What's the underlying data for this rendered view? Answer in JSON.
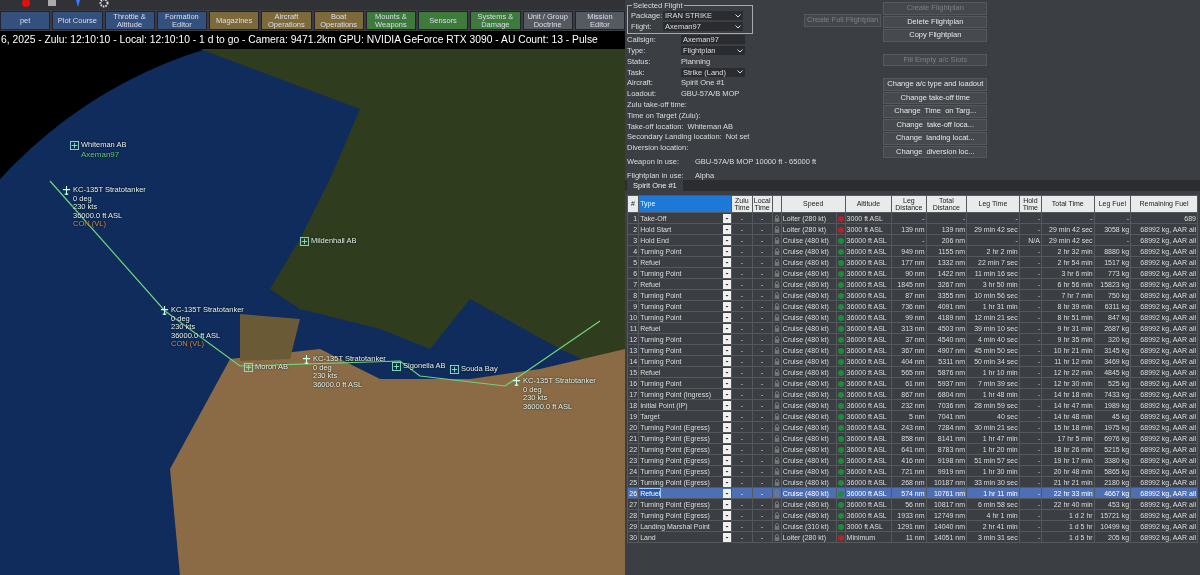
{
  "toolbar": {
    "buttons": [
      {
        "label": "pet"
      },
      {
        "label": "Plot Course"
      },
      {
        "label": "Throttle & Altitude"
      },
      {
        "label": "Formation Editor"
      },
      {
        "label": "Magazines"
      },
      {
        "label": "Aircraft Operations"
      },
      {
        "label": "Boat Operations"
      },
      {
        "label": "Mounts & Weapons"
      },
      {
        "label": "Sensors"
      },
      {
        "label": "Systems & Damage"
      },
      {
        "label": "Unit / Group Doctrine"
      },
      {
        "label": "Mission Editor"
      }
    ]
  },
  "status_line": "6, 2025 - Zulu: 12:10:10 - Local: 12:10:10 - 1 d to go - Camera: 9471.2km GPU: NVIDIA GeForce RTX 3090 - AU Count: 13 - Pulse",
  "map_markers": [
    {
      "kind": "base",
      "label": "Whiteman AB",
      "sub": "Axeman97"
    },
    {
      "kind": "tanker",
      "label": "KC-135T Stratotanker",
      "details": [
        "0 deg",
        "230 kts",
        "36000.0 ft ASL"
      ],
      "status": "CON (VL)"
    },
    {
      "kind": "base",
      "label": "Mildenhall AB"
    },
    {
      "kind": "tanker",
      "label": "KC-135T Stratotanker",
      "details": [
        "0 deg",
        "230 kts",
        "36000.0 ft ASL"
      ],
      "status": "CON (VL)"
    },
    {
      "kind": "base",
      "label": "Moron AB"
    },
    {
      "kind": "tanker",
      "label": "KC-135T Stratotanker",
      "details": [
        "0 deg",
        "230 kts",
        "36000.0 ft ASL"
      ]
    },
    {
      "kind": "base",
      "label": "Sigonella AB"
    },
    {
      "kind": "base",
      "label": "Souda Bay"
    },
    {
      "kind": "tanker",
      "label": "KC-135T Stratotanker",
      "details": [
        "0 deg",
        "230 kts",
        "36000.0 ft ASL"
      ]
    }
  ],
  "selected_flight": {
    "title": "Selected Flight",
    "package_label": "Package:",
    "package": "IRAN STRIKE",
    "flight_label": "Flight:",
    "flight": "Axeman97"
  },
  "create_full_button": {
    "label": "Create Full Flightplan",
    "disabled": true
  },
  "fields": [
    {
      "label": "Callsign:",
      "value": "Axeman97",
      "kind": "input"
    },
    {
      "label": "Type:",
      "value": "Flightplan",
      "kind": "select"
    },
    {
      "label": "Status:",
      "value": "Planning",
      "kind": "text"
    },
    {
      "label": "Task:",
      "value": "Strike (Land)",
      "kind": "select"
    },
    {
      "label": "Aircraft:",
      "value": "Spirit One #1",
      "kind": "text"
    },
    {
      "label": "Loadout:",
      "value": "GBU-57A/B MOP",
      "kind": "text"
    },
    {
      "label": "Zulu take-off time:",
      "kind": "text"
    },
    {
      "label": "Time on Target (Zulu):",
      "kind": "text"
    },
    {
      "label": "Take-off location:",
      "value": "Whiteman AB",
      "kind": "text"
    },
    {
      "label": "Secondary Landing location:",
      "value": "Not set",
      "kind": "text"
    },
    {
      "label": "Diversion location:",
      "kind": "text"
    },
    {
      "label": "Weapon in use:",
      "value": "GBU-57A/B MOP 10000 ft - 65000 ft",
      "kind": "text"
    },
    {
      "label": "Flightplan in use:",
      "value": "Alpha",
      "kind": "text"
    }
  ],
  "action_groups": [
    {
      "buttons": [
        {
          "label": "Create Flightplan",
          "disabled": true
        },
        {
          "label": "Delete Flightplan",
          "disabled": false
        },
        {
          "label": "Copy Flightplan",
          "disabled": false
        }
      ]
    },
    {
      "buttons": [
        {
          "label": "Fill Empty a/c Slots",
          "disabled": true
        }
      ]
    },
    {
      "buttons": [
        {
          "label": "Change a/c type and loadout",
          "disabled": false
        },
        {
          "label": "Change take-off time",
          "disabled": false
        },
        {
          "label": "Change  Time  on Targ...",
          "disabled": false
        },
        {
          "label": "Change  take-off loca...",
          "disabled": false
        },
        {
          "label": "Change  landing locat...",
          "disabled": false
        },
        {
          "label": "Change  diversion loc...",
          "disabled": false
        }
      ]
    }
  ],
  "tabs": [
    {
      "label": "Spirit One #1",
      "selected": true
    }
  ],
  "table": {
    "columns": [
      {
        "label": "#",
        "selected": false
      },
      {
        "label": "Type",
        "selected": true
      },
      {
        "label": "Zulu Time",
        "selected": false
      },
      {
        "label": "Local Time",
        "selected": false
      },
      {
        "label": "Speed",
        "selected": false
      },
      {
        "label": "Altitude",
        "selected": false
      },
      {
        "label": "Leg Distance",
        "selected": false
      },
      {
        "label": "Total Distance",
        "selected": false
      },
      {
        "label": "Leg Time",
        "selected": false
      },
      {
        "label": "Hold Time",
        "selected": false
      },
      {
        "label": "Total Time",
        "selected": false
      },
      {
        "label": "Leg Fuel",
        "selected": false
      },
      {
        "label": "Remaining Fuel",
        "selected": false
      }
    ],
    "rows": [
      {
        "n": "1",
        "type": "Take-Off",
        "zulu": "-",
        "local": "-",
        "speed": "Loiter (280 kt)",
        "color": "#b3232a",
        "altitude": "3000 ft ASL",
        "leg_distance": "-",
        "total_distance": "-",
        "leg_time": "-",
        "hold_time": "-",
        "total_time": "-",
        "leg_fuel": "-",
        "remaining_fuel": "689",
        "selected": false
      },
      {
        "n": "2",
        "type": "Hold Start",
        "zulu": "-",
        "local": "-",
        "speed": "Loiter (280 kt)",
        "color": "#b3232a",
        "altitude": "3000 ft ASL",
        "leg_distance": "139 nm",
        "total_distance": "139 nm",
        "leg_time": "29 min 42 sec",
        "hold_time": "-",
        "total_time": "29 min 42 sec",
        "leg_fuel": "3058 kg",
        "remaining_fuel": "68992 kg, AAR all",
        "selected": false
      },
      {
        "n": "3",
        "type": "Hold End",
        "zulu": "-",
        "local": "-",
        "speed": "Cruise (480 kt)",
        "color": "#1f8a3a",
        "altitude": "36000 ft ASL",
        "leg_distance": "-",
        "total_distance": "206 nm",
        "leg_time": "-",
        "hold_time": "N/A",
        "total_time": "29 min 42 sec",
        "leg_fuel": "-",
        "remaining_fuel": "68992 kg, AAR all",
        "selected": false
      },
      {
        "n": "4",
        "type": "Turning Point",
        "zulu": "-",
        "local": "-",
        "speed": "Cruise (480 kt)",
        "color": "#1f8a3a",
        "altitude": "36000 ft ASL",
        "leg_distance": "949 nm",
        "total_distance": "1155 nm",
        "leg_time": "2 hr 2 min",
        "hold_time": "-",
        "total_time": "2 hr 32 min",
        "leg_fuel": "8880 kg",
        "remaining_fuel": "68992 kg, AAR all",
        "selected": false
      },
      {
        "n": "5",
        "type": "Refuel",
        "zulu": "-",
        "local": "-",
        "speed": "Cruise (480 kt)",
        "color": "#1f8a3a",
        "altitude": "36000 ft ASL",
        "leg_distance": "177 nm",
        "total_distance": "1332 nm",
        "leg_time": "22 min 7 sec",
        "hold_time": "-",
        "total_time": "2 hr 54 min",
        "leg_fuel": "1517 kg",
        "remaining_fuel": "68992 kg, AAR all",
        "selected": false
      },
      {
        "n": "6",
        "type": "Turning Point",
        "zulu": "-",
        "local": "-",
        "speed": "Cruise (480 kt)",
        "color": "#1f8a3a",
        "altitude": "36000 ft ASL",
        "leg_distance": "90 nm",
        "total_distance": "1422 nm",
        "leg_time": "11 min 16 sec",
        "hold_time": "-",
        "total_time": "3 hr 6 min",
        "leg_fuel": "773 kg",
        "remaining_fuel": "68992 kg, AAR all",
        "selected": false
      },
      {
        "n": "7",
        "type": "Refuel",
        "zulu": "-",
        "local": "-",
        "speed": "Cruise (480 kt)",
        "color": "#1f8a3a",
        "altitude": "36000 ft ASL",
        "leg_distance": "1845 nm",
        "total_distance": "3267 nm",
        "leg_time": "3 hr 50 min",
        "hold_time": "-",
        "total_time": "6 hr 56 min",
        "leg_fuel": "15823 kg",
        "remaining_fuel": "68992 kg, AAR all",
        "selected": false
      },
      {
        "n": "8",
        "type": "Turning Point",
        "zulu": "-",
        "local": "-",
        "speed": "Cruise (480 kt)",
        "color": "#1f8a3a",
        "altitude": "36000 ft ASL",
        "leg_distance": "87 nm",
        "total_distance": "3355 nm",
        "leg_time": "10 min 56 sec",
        "hold_time": "-",
        "total_time": "7 hr 7 min",
        "leg_fuel": "750 kg",
        "remaining_fuel": "68992 kg, AAR all",
        "selected": false
      },
      {
        "n": "9",
        "type": "Turning Point",
        "zulu": "-",
        "local": "-",
        "speed": "Cruise (480 kt)",
        "color": "#1f8a3a",
        "altitude": "36000 ft ASL",
        "leg_distance": "736 nm",
        "total_distance": "4091 nm",
        "leg_time": "1 hr 31 min",
        "hold_time": "-",
        "total_time": "8 hr 39 min",
        "leg_fuel": "6311 kg",
        "remaining_fuel": "68992 kg, AAR all",
        "selected": false
      },
      {
        "n": "10",
        "type": "Turning Point",
        "zulu": "-",
        "local": "-",
        "speed": "Cruise (480 kt)",
        "color": "#1f8a3a",
        "altitude": "36000 ft ASL",
        "leg_distance": "99 nm",
        "total_distance": "4189 nm",
        "leg_time": "12 min 21 sec",
        "hold_time": "-",
        "total_time": "8 hr 51 min",
        "leg_fuel": "847 kg",
        "remaining_fuel": "68992 kg, AAR all",
        "selected": false
      },
      {
        "n": "11",
        "type": "Refuel",
        "zulu": "-",
        "local": "-",
        "speed": "Cruise (480 kt)",
        "color": "#1f8a3a",
        "altitude": "36000 ft ASL",
        "leg_distance": "313 nm",
        "total_distance": "4503 nm",
        "leg_time": "39 min 10 sec",
        "hold_time": "-",
        "total_time": "9 hr 31 min",
        "leg_fuel": "2687 kg",
        "remaining_fuel": "68992 kg, AAR all",
        "selected": false
      },
      {
        "n": "12",
        "type": "Turning Point",
        "zulu": "-",
        "local": "-",
        "speed": "Cruise (480 kt)",
        "color": "#1f8a3a",
        "altitude": "36000 ft ASL",
        "leg_distance": "37 nm",
        "total_distance": "4540 nm",
        "leg_time": "4 min 40 sec",
        "hold_time": "-",
        "total_time": "9 hr 35 min",
        "leg_fuel": "320 kg",
        "remaining_fuel": "68992 kg, AAR all",
        "selected": false
      },
      {
        "n": "13",
        "type": "Turning Point",
        "zulu": "-",
        "local": "-",
        "speed": "Cruise (480 kt)",
        "color": "#1f8a3a",
        "altitude": "36000 ft ASL",
        "leg_distance": "367 nm",
        "total_distance": "4907 nm",
        "leg_time": "45 min 50 sec",
        "hold_time": "-",
        "total_time": "10 hr 21 min",
        "leg_fuel": "3145 kg",
        "remaining_fuel": "68992 kg, AAR all",
        "selected": false
      },
      {
        "n": "14",
        "type": "Turning Point",
        "zulu": "-",
        "local": "-",
        "speed": "Cruise (480 kt)",
        "color": "#1f8a3a",
        "altitude": "36000 ft ASL",
        "leg_distance": "404 nm",
        "total_distance": "5311 nm",
        "leg_time": "50 min 34 sec",
        "hold_time": "-",
        "total_time": "11 hr 12 min",
        "leg_fuel": "3469 kg",
        "remaining_fuel": "68992 kg, AAR all",
        "selected": false
      },
      {
        "n": "15",
        "type": "Refuel",
        "zulu": "-",
        "local": "-",
        "speed": "Cruise (480 kt)",
        "color": "#1f8a3a",
        "altitude": "36000 ft ASL",
        "leg_distance": "565 nm",
        "total_distance": "5876 nm",
        "leg_time": "1 hr 10 min",
        "hold_time": "-",
        "total_time": "12 hr 22 min",
        "leg_fuel": "4845 kg",
        "remaining_fuel": "68992 kg, AAR all",
        "selected": false
      },
      {
        "n": "16",
        "type": "Turning Point",
        "zulu": "-",
        "local": "-",
        "speed": "Cruise (480 kt)",
        "color": "#1f8a3a",
        "altitude": "36000 ft ASL",
        "leg_distance": "61 nm",
        "total_distance": "5937 nm",
        "leg_time": "7 min 39 sec",
        "hold_time": "-",
        "total_time": "12 hr 30 min",
        "leg_fuel": "525 kg",
        "remaining_fuel": "68992 kg, AAR all",
        "selected": false
      },
      {
        "n": "17",
        "type": "Turning Point (Ingress)",
        "zulu": "-",
        "local": "-",
        "speed": "Cruise (480 kt)",
        "color": "#1f8a3a",
        "altitude": "36000 ft ASL",
        "leg_distance": "867 nm",
        "total_distance": "6804 nm",
        "leg_time": "1 hr 48 min",
        "hold_time": "-",
        "total_time": "14 hr 18 min",
        "leg_fuel": "7433 kg",
        "remaining_fuel": "68992 kg, AAR all",
        "selected": false
      },
      {
        "n": "18",
        "type": "Initial Point (IP)",
        "zulu": "-",
        "local": "-",
        "speed": "Cruise (480 kt)",
        "color": "#1f8a3a",
        "altitude": "36000 ft ASL",
        "leg_distance": "232 nm",
        "total_distance": "7036 nm",
        "leg_time": "28 min 59 sec",
        "hold_time": "-",
        "total_time": "14 hr 47 min",
        "leg_fuel": "1989 kg",
        "remaining_fuel": "68992 kg, AAR all",
        "selected": false
      },
      {
        "n": "19",
        "type": "Target",
        "zulu": "-",
        "local": "-",
        "speed": "Cruise (480 kt)",
        "color": "#1f8a3a",
        "altitude": "36000 ft ASL",
        "leg_distance": "5 nm",
        "total_distance": "7041 nm",
        "leg_time": "40 sec",
        "hold_time": "-",
        "total_time": "14 hr 48 min",
        "leg_fuel": "45 kg",
        "remaining_fuel": "68992 kg, AAR all",
        "selected": false
      },
      {
        "n": "20",
        "type": "Turning Point (Egress)",
        "zulu": "-",
        "local": "-",
        "speed": "Cruise (480 kt)",
        "color": "#1f8a3a",
        "altitude": "36000 ft ASL",
        "leg_distance": "243 nm",
        "total_distance": "7284 nm",
        "leg_time": "30 min 21 sec",
        "hold_time": "-",
        "total_time": "15 hr 18 min",
        "leg_fuel": "1975 kg",
        "remaining_fuel": "68992 kg, AAR all",
        "selected": false
      },
      {
        "n": "21",
        "type": "Turning Point (Egress)",
        "zulu": "-",
        "local": "-",
        "speed": "Cruise (480 kt)",
        "color": "#1f8a3a",
        "altitude": "36000 ft ASL",
        "leg_distance": "858 nm",
        "total_distance": "8141 nm",
        "leg_time": "1 hr 47 min",
        "hold_time": "-",
        "total_time": "17 hr 5 min",
        "leg_fuel": "6976 kg",
        "remaining_fuel": "68992 kg, AAR all",
        "selected": false
      },
      {
        "n": "22",
        "type": "Turning Point (Egress)",
        "zulu": "-",
        "local": "-",
        "speed": "Cruise (480 kt)",
        "color": "#1f8a3a",
        "altitude": "36000 ft ASL",
        "leg_distance": "641 nm",
        "total_distance": "8783 nm",
        "leg_time": "1 hr 20 min",
        "hold_time": "-",
        "total_time": "18 hr 26 min",
        "leg_fuel": "5215 kg",
        "remaining_fuel": "68992 kg, AAR all",
        "selected": false
      },
      {
        "n": "23",
        "type": "Turning Point (Egress)",
        "zulu": "-",
        "local": "-",
        "speed": "Cruise (480 kt)",
        "color": "#1f8a3a",
        "altitude": "36000 ft ASL",
        "leg_distance": "416 nm",
        "total_distance": "9198 nm",
        "leg_time": "51 min 57 sec",
        "hold_time": "-",
        "total_time": "19 hr 17 min",
        "leg_fuel": "3380 kg",
        "remaining_fuel": "68992 kg, AAR all",
        "selected": false
      },
      {
        "n": "24",
        "type": "Turning Point (Egress)",
        "zulu": "-",
        "local": "-",
        "speed": "Cruise (480 kt)",
        "color": "#1f8a3a",
        "altitude": "36000 ft ASL",
        "leg_distance": "721 nm",
        "total_distance": "9919 nm",
        "leg_time": "1 hr 30 min",
        "hold_time": "-",
        "total_time": "20 hr 48 min",
        "leg_fuel": "5865 kg",
        "remaining_fuel": "68992 kg, AAR all",
        "selected": false
      },
      {
        "n": "25",
        "type": "Turning Point (Egress)",
        "zulu": "-",
        "local": "-",
        "speed": "Cruise (480 kt)",
        "color": "#1f8a3a",
        "altitude": "36000 ft ASL",
        "leg_distance": "268 nm",
        "total_distance": "10187 nm",
        "leg_time": "33 min 30 sec",
        "hold_time": "-",
        "total_time": "21 hr 21 min",
        "leg_fuel": "2180 kg",
        "remaining_fuel": "68992 kg, AAR all",
        "selected": false
      },
      {
        "n": "26",
        "type": "Refuel",
        "zulu": "-",
        "local": "-",
        "speed": "Cruise (480 kt)",
        "color": "#1f8a3a",
        "altitude": "36000 ft ASL",
        "leg_distance": "574 nm",
        "total_distance": "10761 nm",
        "leg_time": "1 hr 11 min",
        "hold_time": "-",
        "total_time": "22 hr 33 min",
        "leg_fuel": "4667 kg",
        "remaining_fuel": "68992 kg, AAR all",
        "selected": true
      },
      {
        "n": "27",
        "type": "Turning Point (Egress)",
        "zulu": "-",
        "local": "-",
        "speed": "Cruise (480 kt)",
        "color": "#1f8a3a",
        "altitude": "36000 ft ASL",
        "leg_distance": "56 nm",
        "total_distance": "10817 nm",
        "leg_time": "6 min 58 sec",
        "hold_time": "-",
        "total_time": "22 hr 40 min",
        "leg_fuel": "453 kg",
        "remaining_fuel": "68992 kg, AAR all",
        "selected": false
      },
      {
        "n": "28",
        "type": "Turning Point (Egress)",
        "zulu": "-",
        "local": "-",
        "speed": "Cruise (480 kt)",
        "color": "#1f8a3a",
        "altitude": "36000 ft ASL",
        "leg_distance": "1933 nm",
        "total_distance": "12749 nm",
        "leg_time": "4 hr 1 min",
        "hold_time": "-",
        "total_time": "1 d 2 hr",
        "leg_fuel": "15721 kg",
        "remaining_fuel": "68992 kg, AAR all",
        "selected": false
      },
      {
        "n": "29",
        "type": "Landing Marshal Point",
        "zulu": "-",
        "local": "-",
        "speed": "Cruise (310 kt)",
        "color": "#1f8a3a",
        "altitude": "3000 ft ASL",
        "leg_distance": "1291 nm",
        "total_distance": "14040 nm",
        "leg_time": "2 hr 41 min",
        "hold_time": "-",
        "total_time": "1 d 5 hr",
        "leg_fuel": "10499 kg",
        "remaining_fuel": "68992 kg, AAR all",
        "selected": false
      },
      {
        "n": "30",
        "type": "Land",
        "zulu": "-",
        "local": "-",
        "speed": "Loiter (280 kt)",
        "color": "#b3232a",
        "altitude": "Minimum",
        "leg_distance": "11 nm",
        "total_distance": "14051 nm",
        "leg_time": "3 min 31 sec",
        "hold_time": "-",
        "total_time": "1 d 5 hr",
        "leg_fuel": "205 kg",
        "remaining_fuel": "68992 kg, AAR all",
        "selected": false
      }
    ]
  }
}
